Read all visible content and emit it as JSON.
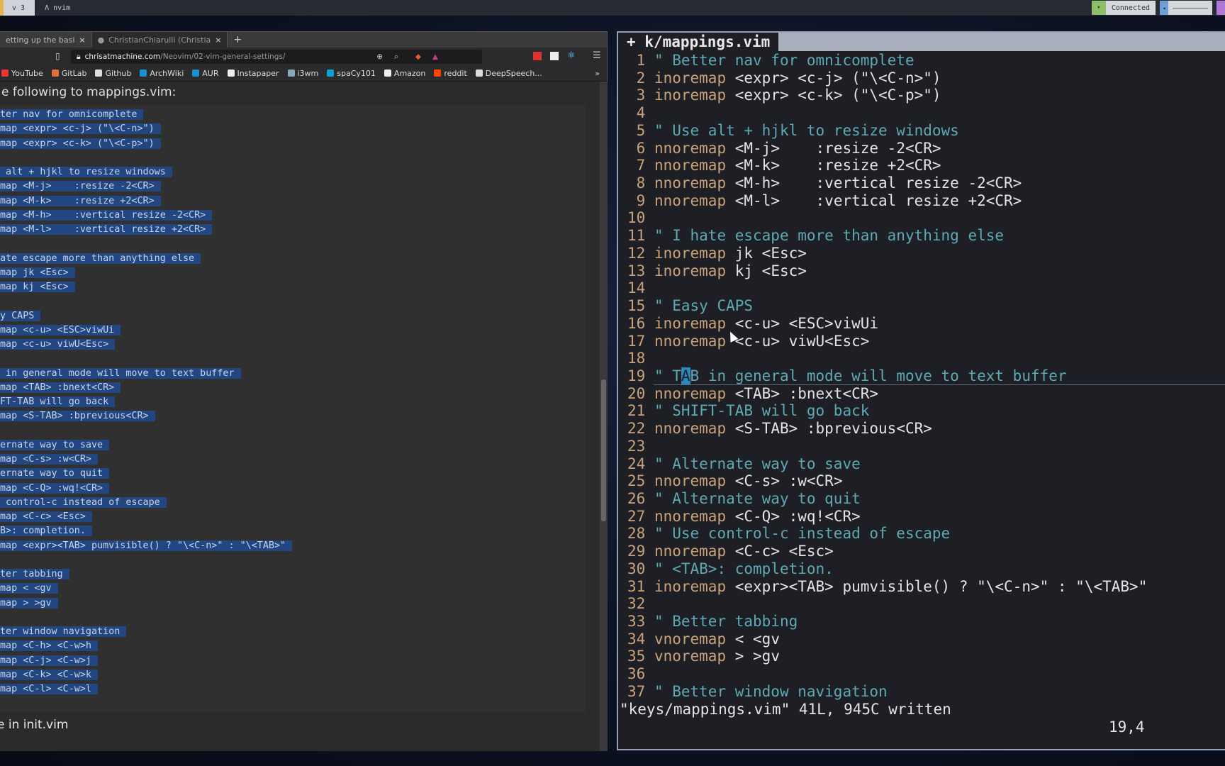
{
  "topbar": {
    "workspace": "v 3",
    "window_title": "nvim",
    "network": "Connected"
  },
  "browser": {
    "tabs": [
      {
        "label": "etting up the basi",
        "active": false
      },
      {
        "label": "ChristianChiarulli (Christia",
        "active": true
      }
    ],
    "new_tab": "+",
    "close": "×",
    "url_domain": "chrisatmachine.com",
    "url_path": "/Neovim/02-vim-general-settings/",
    "bookmarks": [
      "YouTube",
      "GitLab",
      "Github",
      "ArchWiki",
      "AUR",
      "Instapaper",
      "i3wm",
      "spaCy101",
      "Amazon",
      "reddit",
      "DeepSpeech..."
    ],
    "bookmark_colors": [
      "#e33",
      "#e2703a",
      "#ddd",
      "#1793d1",
      "#1793d1",
      "#eee",
      "#8ab",
      "#09a3d5",
      "#eee",
      "#ff4500",
      "#ddd"
    ],
    "more": "»",
    "intro": "e following to mappings.vim:",
    "code": [
      "ter nav for omnicomplete",
      "map <expr> <c-j> (\"\\<C-n>\")",
      "map <expr> <c-k> (\"\\<C-p>\")",
      "",
      " alt + hjkl to resize windows",
      "map <M-j>    :resize -2<CR>",
      "map <M-k>    :resize +2<CR>",
      "map <M-h>    :vertical resize -2<CR>",
      "map <M-l>    :vertical resize +2<CR>",
      "",
      "ate escape more than anything else",
      "map jk <Esc>",
      "map kj <Esc>",
      "",
      "y CAPS",
      "map <c-u> <ESC>viwUi",
      "map <c-u> viwU<Esc>",
      "",
      " in general mode will move to text buffer",
      "map <TAB> :bnext<CR>",
      "FT-TAB will go back",
      "map <S-TAB> :bprevious<CR>",
      "",
      "ernate way to save",
      "map <C-s> :w<CR>",
      "ernate way to quit",
      "map <C-Q> :wq!<CR>",
      " control-c instead of escape",
      "map <C-c> <Esc>",
      "B>: completion.",
      "map <expr><TAB> pumvisible() ? \"\\<C-n>\" : \"\\<TAB>\"",
      "",
      "ter tabbing",
      "map < <gv",
      "map > >gv",
      "",
      "ter window navigation",
      "map <C-h> <C-w>h",
      "map <C-j> <C-w>j",
      "map <C-k> <C-w>k",
      "map <C-l> <C-w>l"
    ],
    "footer": "e in init.vim"
  },
  "vim": {
    "title": "+ k/mappings.vim",
    "lines": [
      [
        "c",
        "\" Better nav for omnicomplete"
      ],
      [
        "k",
        "inoremap",
        "<expr> <c-j> (\"\\<C-n>\")"
      ],
      [
        "k",
        "inoremap",
        "<expr> <c-k> (\"\\<C-p>\")"
      ],
      [
        "e",
        ""
      ],
      [
        "c",
        "\" Use alt + hjkl to resize windows"
      ],
      [
        "k",
        "nnoremap",
        "<M-j>    :resize -2<CR>"
      ],
      [
        "k",
        "nnoremap",
        "<M-k>    :resize +2<CR>"
      ],
      [
        "k",
        "nnoremap",
        "<M-h>    :vertical resize -2<CR>"
      ],
      [
        "k",
        "nnoremap",
        "<M-l>    :vertical resize +2<CR>"
      ],
      [
        "e",
        ""
      ],
      [
        "c",
        "\" I hate escape more than anything else"
      ],
      [
        "k",
        "inoremap",
        "jk <Esc>"
      ],
      [
        "k",
        "inoremap",
        "kj <Esc>"
      ],
      [
        "e",
        ""
      ],
      [
        "c",
        "\" Easy CAPS"
      ],
      [
        "k",
        "inoremap",
        "<c-u> <ESC>viwUi"
      ],
      [
        "k",
        "nnoremap",
        "<c-u> viwU<Esc>"
      ],
      [
        "e",
        ""
      ],
      [
        "c",
        "\" TAB in general mode will move to text buffer"
      ],
      [
        "k",
        "nnoremap",
        "<TAB> :bnext<CR>"
      ],
      [
        "c",
        "\" SHIFT-TAB will go back"
      ],
      [
        "k",
        "nnoremap",
        "<S-TAB> :bprevious<CR>"
      ],
      [
        "e",
        ""
      ],
      [
        "c",
        "\" Alternate way to save"
      ],
      [
        "k",
        "nnoremap",
        "<C-s> :w<CR>"
      ],
      [
        "c",
        "\" Alternate way to quit"
      ],
      [
        "k",
        "nnoremap",
        "<C-Q> :wq!<CR>"
      ],
      [
        "c",
        "\" Use control-c instead of escape"
      ],
      [
        "k",
        "nnoremap",
        "<C-c> <Esc>"
      ],
      [
        "c",
        "\" <TAB>: completion."
      ],
      [
        "k",
        "inoremap",
        "<expr><TAB> pumvisible() ? \"\\<C-n>\" : \"\\<TAB>\""
      ],
      [
        "e",
        ""
      ],
      [
        "c",
        "\" Better tabbing"
      ],
      [
        "k",
        "vnoremap",
        "< <gv"
      ],
      [
        "k",
        "vnoremap",
        "> >gv"
      ],
      [
        "e",
        ""
      ],
      [
        "c",
        "\" Better window navigation"
      ]
    ],
    "cursor_line": 19,
    "cursor_col": 4,
    "message": "\"keys/mappings.vim\" 41L, 945C written",
    "position": "19,4"
  }
}
